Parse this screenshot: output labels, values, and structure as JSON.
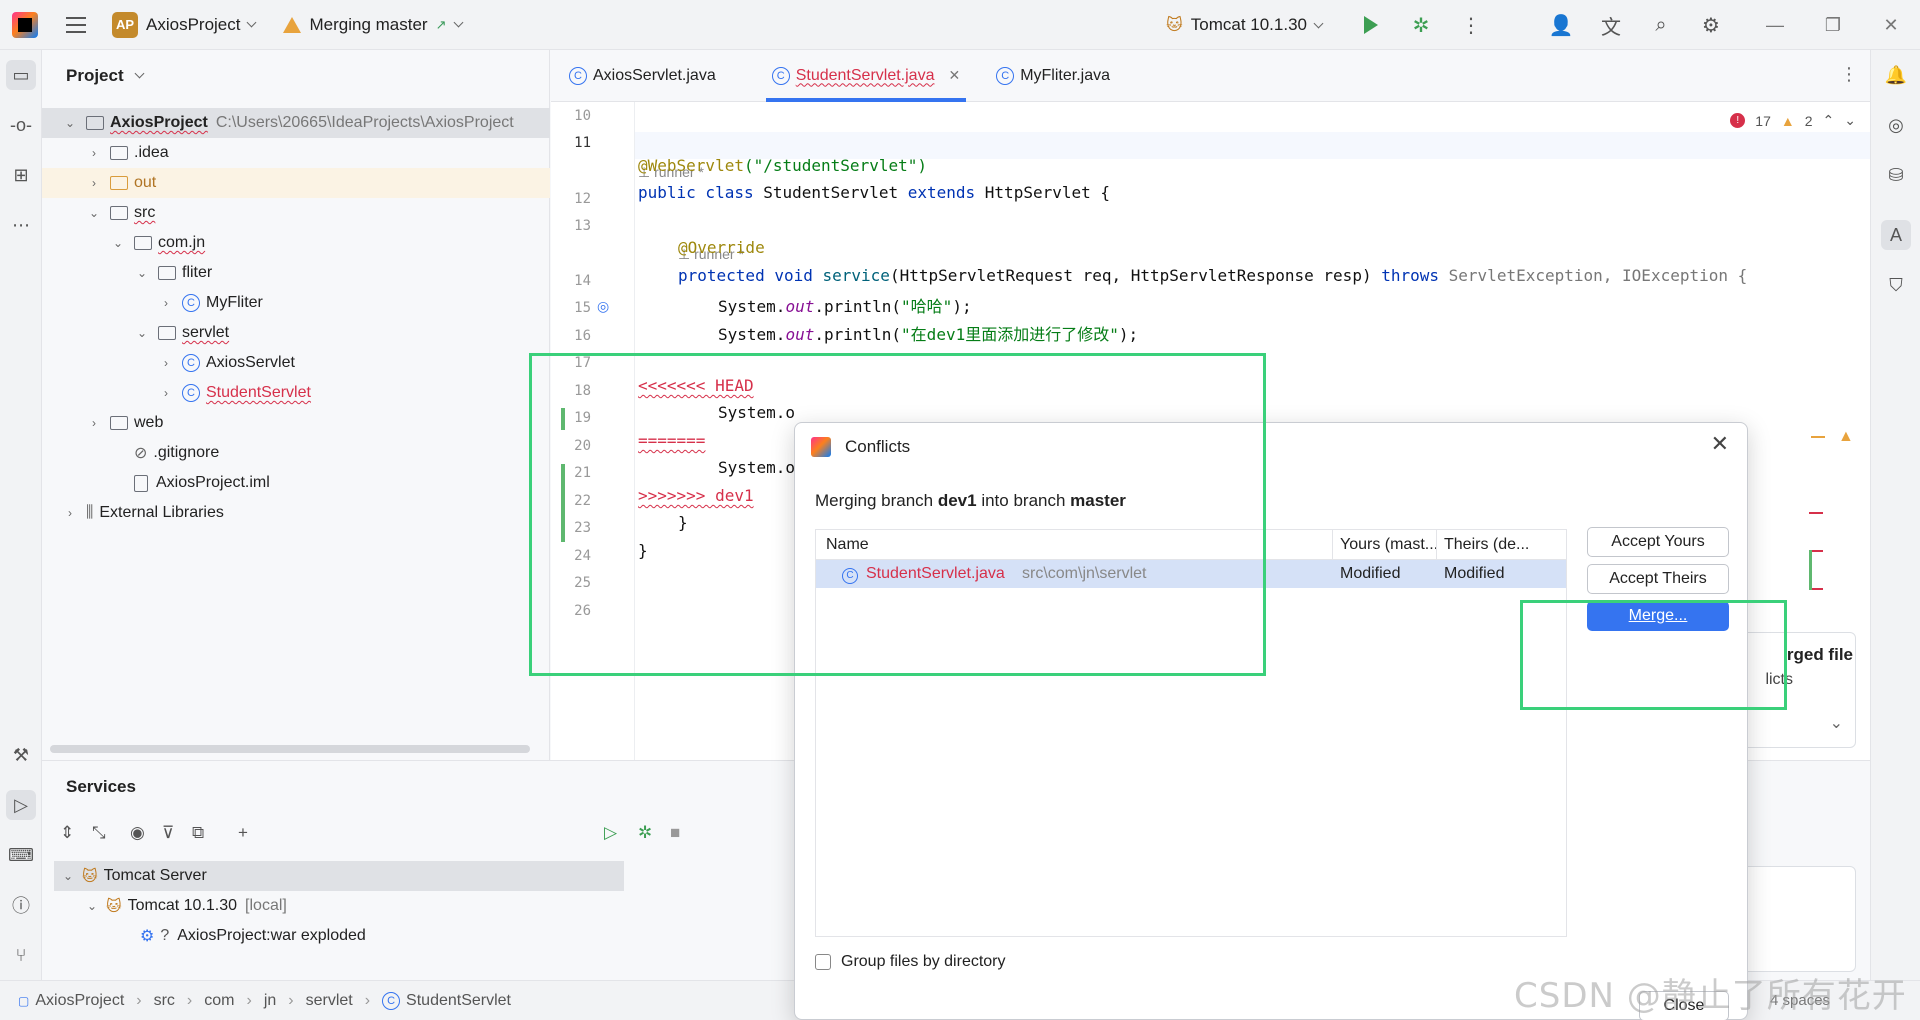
{
  "titlebar": {
    "project_badge": "AP",
    "project_name": "AxiosProject",
    "vcs_status": "Merging master",
    "vcs_arrow": "↗",
    "run_config": "Tomcat 10.1.30"
  },
  "project_panel": {
    "title": "Project",
    "tree": [
      {
        "label": "AxiosProject",
        "path": "C:\\Users\\20665\\IdeaProjects\\AxiosProject"
      },
      {
        "label": ".idea"
      },
      {
        "label": "out"
      },
      {
        "label": "src"
      },
      {
        "label": "com.jn"
      },
      {
        "label": "fliter"
      },
      {
        "label": "MyFliter"
      },
      {
        "label": "servlet"
      },
      {
        "label": "AxiosServlet"
      },
      {
        "label": "StudentServlet"
      },
      {
        "label": "web"
      },
      {
        "label": ".gitignore"
      },
      {
        "label": "AxiosProject.iml"
      },
      {
        "label": "External Libraries"
      }
    ]
  },
  "tabs": [
    {
      "label": "AxiosServlet.java"
    },
    {
      "label": "StudentServlet.java"
    },
    {
      "label": "MyFliter.java"
    }
  ],
  "editor": {
    "inspections": {
      "errors": "17",
      "warnings": "2"
    },
    "hint_runner": "runner *",
    "lines": {
      "l10": "10",
      "l11": "11",
      "l12": "12",
      "l13": "13",
      "l14": "14",
      "l15": "15",
      "l16": "16",
      "l17": "17",
      "l18": "18",
      "l19": "19",
      "l20": "20",
      "l21": "21",
      "l22": "22",
      "l23": "23",
      "l24": "24",
      "l25": "25",
      "l26": "26"
    },
    "code": {
      "webservlet_ann": "@WebServlet",
      "webservlet_arg": "(\"/studentServlet\")",
      "class_kw": "public class",
      "class_name": " StudentServlet ",
      "extends_kw": "extends",
      "class_rest": " HttpServlet {",
      "override": "@Override",
      "method_kw": "protected void",
      "method_name": "service",
      "method_params": "(HttpServletRequest req, HttpServletResponse resp) ",
      "throws_kw": "throws",
      "method_ex": " ServletException, IOException {",
      "print1_pre": "System.",
      "print1_out": "out",
      "print1_mid": ".println(",
      "print1_str": "\"哈哈\"",
      "print1_end": ");",
      "print2_str": "\"在dev1里面添加进行了修改\"",
      "conflict_head": "<<<<<<< HEAD",
      "line20": "System.o",
      "conflict_sep": "=======",
      "line22": "System.o",
      "conflict_end": ">>>>>>> dev1",
      "brace_inner": "}",
      "brace_outer": "}"
    }
  },
  "dialog": {
    "title": "Conflicts",
    "desc_pre": "Merging branch ",
    "desc_src": "dev1",
    "desc_mid": " into branch ",
    "desc_dst": "master",
    "columns": {
      "name": "Name",
      "yours": "Yours (mast...",
      "theirs": "Theirs (de..."
    },
    "rows": [
      {
        "file": "StudentServlet.java",
        "path": "src\\com\\jn\\servlet",
        "yours": "Modified",
        "theirs": "Modified"
      }
    ],
    "btn_accept_yours": "Accept Yours",
    "btn_accept_theirs": "Accept Theirs",
    "btn_merge": "Merge...",
    "group_checkbox": "Group files by directory",
    "btn_close": "Close"
  },
  "notification": {
    "line1": "rged file",
    "line2": "licts"
  },
  "services": {
    "title": "Services",
    "tree": [
      {
        "label": "Tomcat Server"
      },
      {
        "label": "Tomcat 10.1.30",
        "suffix": "[local]"
      },
      {
        "label": "AxiosProject:war exploded"
      }
    ]
  },
  "statusbar": {
    "breadcrumb": [
      "AxiosProject",
      "src",
      "com",
      "jn",
      "servlet",
      "StudentServlet"
    ],
    "right": "4 spaces"
  },
  "watermark": "CSDN @静止了所有花开",
  "colors": {
    "accent": "#3574f0",
    "conflict_red": "#d6304a",
    "annotation_green": "#3ad07a",
    "diff_green": "#5fb86f"
  }
}
